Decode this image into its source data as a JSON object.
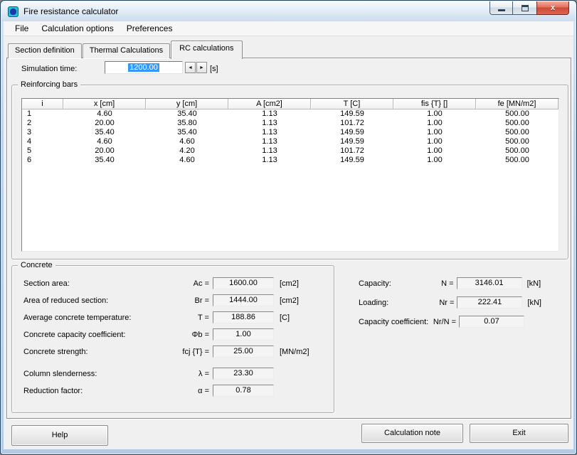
{
  "window": {
    "title": "Fire resistance calculator"
  },
  "caption": {
    "close_glyph": "x"
  },
  "menu": {
    "items": [
      "File",
      "Calculation options",
      "Preferences"
    ]
  },
  "tabs": [
    {
      "label": "Section definition",
      "active": false
    },
    {
      "label": "Thermal Calculations",
      "active": false
    },
    {
      "label": "RC calculations",
      "active": true
    }
  ],
  "simulation_time": {
    "label": "Simulation time:",
    "value": "1200.00",
    "unit": "[s]",
    "spin_left": "◄",
    "spin_right": "►"
  },
  "reinforcing_bars": {
    "group_label": "Reinforcing bars",
    "columns": [
      "i",
      "x [cm]",
      "y [cm]",
      "A [cm2]",
      "T [C]",
      "fis {T} []",
      "fe [MN/m2]"
    ],
    "rows": [
      [
        "1",
        "4.60",
        "35.40",
        "1.13",
        "149.59",
        "1.00",
        "500.00"
      ],
      [
        "2",
        "20.00",
        "35.80",
        "1.13",
        "101.72",
        "1.00",
        "500.00"
      ],
      [
        "3",
        "35.40",
        "35.40",
        "1.13",
        "149.59",
        "1.00",
        "500.00"
      ],
      [
        "4",
        "4.60",
        "4.60",
        "1.13",
        "149.59",
        "1.00",
        "500.00"
      ],
      [
        "5",
        "20.00",
        "4.20",
        "1.13",
        "101.72",
        "1.00",
        "500.00"
      ],
      [
        "6",
        "35.40",
        "4.60",
        "1.13",
        "149.59",
        "1.00",
        "500.00"
      ]
    ]
  },
  "concrete": {
    "group_label": "Concrete",
    "fields": [
      {
        "label": "Section area:",
        "symbol": "Ac =",
        "value": "1600.00",
        "unit": "[cm2]",
        "gap_before": false
      },
      {
        "label": "Area of reduced section:",
        "symbol": "Br =",
        "value": "1444.00",
        "unit": "[cm2]",
        "gap_before": false
      },
      {
        "label": "Average concrete temperature:",
        "symbol": "T =",
        "value": "188.86",
        "unit": "[C]",
        "gap_before": false
      },
      {
        "label": "Concrete capacity coefficient:",
        "symbol": "Φb =",
        "value": "1.00",
        "unit": "",
        "gap_before": false
      },
      {
        "label": "Concrete strength:",
        "symbol": "fcj {T} =",
        "value": "25.00",
        "unit": "[MN/m2]",
        "gap_before": false
      },
      {
        "label": "Column slenderness:",
        "symbol": "λ =",
        "value": "23.30",
        "unit": "",
        "gap_before": true
      },
      {
        "label": "Reduction factor:",
        "symbol": "α =",
        "value": "0.78",
        "unit": "",
        "gap_before": false
      }
    ]
  },
  "results": {
    "fields": [
      {
        "label": "Capacity:",
        "symbol": "N =",
        "value": "3146.01",
        "unit": "[kN]"
      },
      {
        "label": "Loading:",
        "symbol": "Nr =",
        "value": "222.41",
        "unit": "[kN]"
      },
      {
        "label": "Capacity coefficient:",
        "symbol": "Nr/N =",
        "value": "0.07",
        "unit": ""
      }
    ]
  },
  "footer": {
    "help": "Help",
    "calculation_note": "Calculation note",
    "exit": "Exit"
  },
  "colors": {
    "selection_highlight": "#3399FF",
    "close_button_red": "#CE4A35",
    "frame_blue": "#BDD2EA",
    "dialog_gray": "#F0F0F0"
  }
}
